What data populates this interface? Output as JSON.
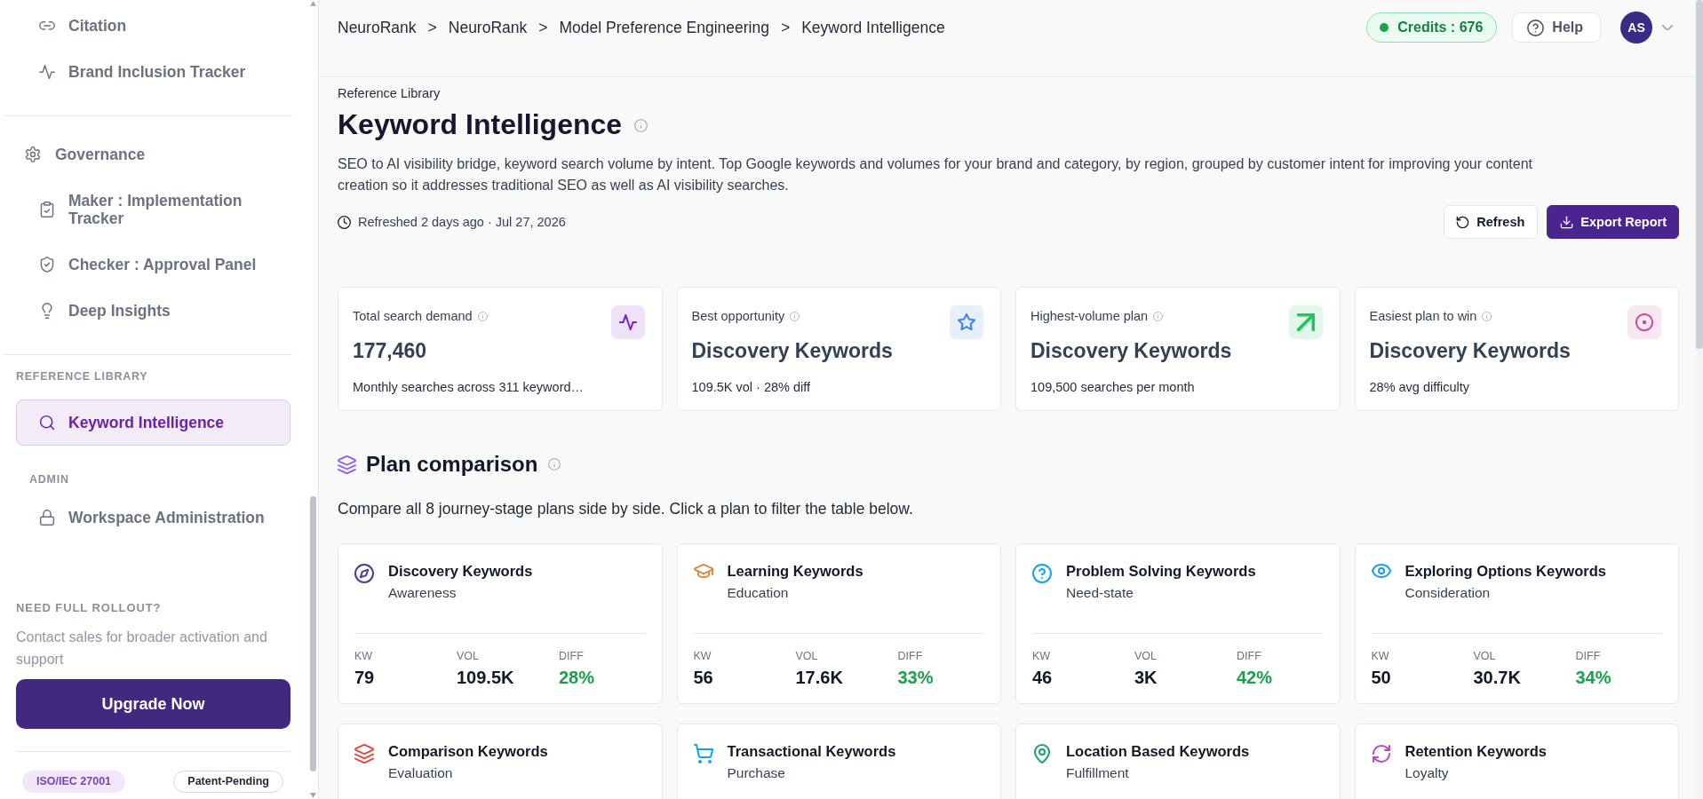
{
  "sidebar": {
    "nav_groups": [
      {
        "children": [
          {
            "label": "Citation",
            "selected": false
          },
          {
            "label": "Brand Inclusion Tracker",
            "selected": false
          }
        ]
      },
      {
        "label": "Governance",
        "children": [
          {
            "label": "Maker : Implementation Tracker",
            "selected": false
          },
          {
            "label": "Checker : Approval Panel",
            "selected": false
          },
          {
            "label": "Deep Insights",
            "selected": false
          }
        ]
      }
    ],
    "sections": [
      {
        "heading": "REFERENCE LIBRARY",
        "items": [
          {
            "label": "Keyword Intelligence",
            "selected": true
          }
        ]
      },
      {
        "heading": "ADMIN",
        "items": [
          {
            "label": "Workspace Administration",
            "selected": false
          }
        ]
      }
    ],
    "promo": {
      "heading": "NEED FULL ROLLOUT?",
      "text": "Contact sales for broader activation and support",
      "button": "Upgrade Now"
    },
    "badges": [
      {
        "label": "ISO/IEC 27001",
        "kind": "certification"
      },
      {
        "label": "Patent-Pending",
        "kind": "outline"
      }
    ]
  },
  "top_bar": {
    "breadcrumb": [
      {
        "label": "NeuroRank"
      },
      {
        "separator": ">",
        "label": "NeuroRank"
      },
      {
        "separator": ">",
        "label": "Model Preference Engineering"
      },
      {
        "separator": ">",
        "label": "Keyword Intelligence"
      }
    ],
    "credits": "Credits : 676",
    "help": "Help",
    "avatar": "AS"
  },
  "page": {
    "eyebrow": "Reference Library",
    "title": "Keyword Intelligence",
    "description": "SEO to AI visibility bridge, keyword search volume by intent. Top Google keywords and volumes for your brand and category, by region, grouped by customer intent for improving your content creation so it addresses traditional SEO as well as AI visibility searches.",
    "refreshed": "Refreshed 2 days ago · Jul 27, 2026",
    "actions": [
      {
        "label": "Refresh",
        "kind": "secondary"
      },
      {
        "label": "Export Report",
        "kind": "primary"
      }
    ]
  },
  "stats": [
    {
      "label": "Total search demand",
      "value": "177,460",
      "note": "Monthly searches across 311 keyword…",
      "color": "#7e22ce"
    },
    {
      "label": "Best opportunity",
      "value": "Discovery Keywords",
      "note": "109.5K vol · 28% diff",
      "color": "#3b82f6"
    },
    {
      "label": "Highest-volume plan",
      "value": "Discovery Keywords",
      "note": "109,500 searches per month",
      "color": "#22c55e"
    },
    {
      "label": "Easiest plan to win",
      "value": "Discovery Keywords",
      "note": "28% avg difficulty",
      "color": "#d04f9c"
    }
  ],
  "plan_comparison": {
    "title": "Plan comparison",
    "description": "Compare all 8 journey-stage plans side by side. Click a plan to filter the table below.",
    "plans": [
      {
        "title": "Discovery Keywords",
        "stage": "Awareness",
        "color": "#4c3d9b",
        "stats": [
          {
            "kind": "count",
            "label": "KW",
            "value": "79"
          },
          {
            "kind": "volume",
            "label": "VOL",
            "value": "109.5K"
          },
          {
            "kind": "difficulty",
            "label": "DIFF",
            "value": "28%"
          }
        ]
      },
      {
        "title": "Learning Keywords",
        "stage": "Education",
        "color": "#e0873a",
        "stats": [
          {
            "kind": "count",
            "label": "KW",
            "value": "56"
          },
          {
            "kind": "volume",
            "label": "VOL",
            "value": "17.6K"
          },
          {
            "kind": "difficulty",
            "label": "DIFF",
            "value": "33%"
          }
        ]
      },
      {
        "title": "Problem Solving Keywords",
        "stage": "Need-state",
        "color": "#0ea5e9",
        "stats": [
          {
            "kind": "count",
            "label": "KW",
            "value": "46"
          },
          {
            "kind": "volume",
            "label": "VOL",
            "value": "3K"
          },
          {
            "kind": "difficulty",
            "label": "DIFF",
            "value": "42%"
          }
        ]
      },
      {
        "title": "Exploring Options Keywords",
        "stage": "Consideration",
        "color": "#1a9fe0",
        "stats": [
          {
            "kind": "count",
            "label": "KW",
            "value": "50"
          },
          {
            "kind": "volume",
            "label": "VOL",
            "value": "30.7K"
          },
          {
            "kind": "difficulty",
            "label": "DIFF",
            "value": "34%"
          }
        ]
      },
      {
        "title": "Comparison Keywords",
        "stage": "Evaluation",
        "color": "#e5483a"
      },
      {
        "title": "Transactional Keywords",
        "stage": "Purchase",
        "color": "#12a4e6"
      },
      {
        "title": "Location Based Keywords",
        "stage": "Fulfillment",
        "color": "#13a36b"
      },
      {
        "title": "Retention Keywords",
        "stage": "Loyalty",
        "color": "#c245b5"
      }
    ]
  }
}
